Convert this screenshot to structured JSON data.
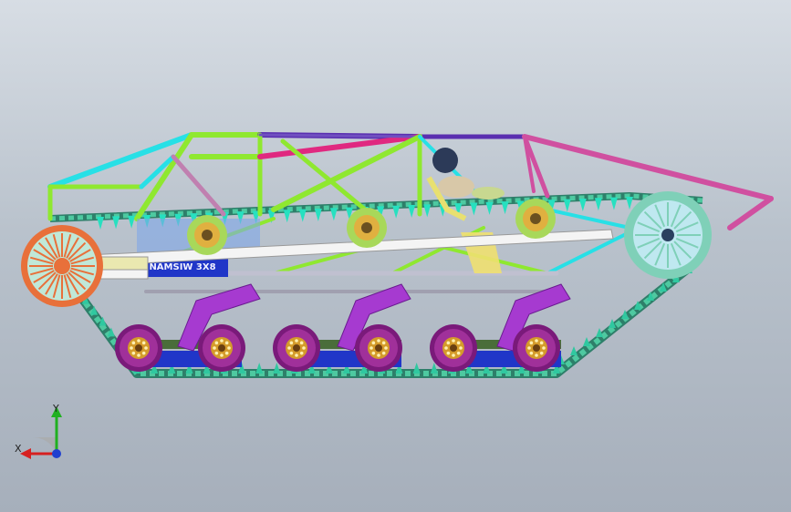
{
  "viewport": {
    "background_top": "#d7dde4",
    "background_bottom": "#a6afbb"
  },
  "model": {
    "name_plate_text": "NAMSIW 3X8",
    "colors": {
      "frame_cyan": "#27e0e6",
      "frame_green": "#8fe830",
      "frame_magenta": "#e02880",
      "frame_purple": "#5a2fb0",
      "frame_pink": "#d050a0",
      "track_teal": "#4ec9a0",
      "track_dark": "#2e7f6a",
      "wheel_purple": "#a0309a",
      "wheel_hub": "#d49b2a",
      "swingarm": "#a63ad0",
      "sprocket_orange": "#e8703a",
      "idler_teal": "#7fd0b8",
      "rail_white": "#f4f4f4",
      "body_blue": "#2036c8"
    }
  },
  "triad": {
    "x_label": "X",
    "y_label": "Y",
    "x_color": "#d62020",
    "y_color": "#20b020",
    "z_color": "#2040d0"
  }
}
